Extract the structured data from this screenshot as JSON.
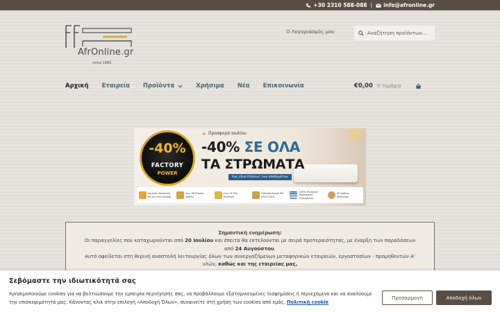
{
  "topbar": {
    "phone": "+30 2310 588-088",
    "separator": "|",
    "email": "info@afronline.gr"
  },
  "logo": {
    "name": "AfrOnline.gr",
    "since": "since 1982"
  },
  "header": {
    "account_label": "Ο Λογαριασμός μου",
    "search_placeholder": "Αναζήτηση προϊόντων..."
  },
  "nav": {
    "items": [
      {
        "label": "Αρχική"
      },
      {
        "label": "Εταιρεία"
      },
      {
        "label": "Προϊόντα"
      },
      {
        "label": "Χρήσιμα"
      },
      {
        "label": "Νέα"
      },
      {
        "label": "Επικοινωνία"
      }
    ]
  },
  "cart": {
    "amount": "€0,00",
    "count": "0 τεμάχια"
  },
  "banner": {
    "badge_percent": "-40%",
    "badge_line1": "FACTORY",
    "badge_line2": "POWER",
    "tag": "Προσφορά Ιουλίου",
    "headline_prefix": "-40%",
    "headline_highlight": "ΣΕ ΟΛΑ",
    "headline_line2": "ΤΑ ΣΤΡΩΜΑΤΑ",
    "subline": "έως εξαντλήσεως των αποθεμάτων",
    "features": [
      {
        "text": "Δωρεάν Αποστολή σε όλη την Ελλάδα",
        "color": "#e8a23a"
      },
      {
        "text": "έως 36 Άτοκες Δόσεις",
        "color": "#d4a347"
      },
      {
        "text": "έως 15 Έτη Εγγύηση",
        "color": "#e0b450"
      },
      {
        "text": "Πιστοποιητικό ISO 9001:2015",
        "color": "#c9a24a"
      },
      {
        "text": "100% Ελληνικό Βιομηχανία Στρωμάτων",
        "color": "#2e5d8c"
      },
      {
        "text": "45 Χρόνια Εμπειρίας",
        "color": "#caa25a"
      }
    ]
  },
  "notice": {
    "title": "Σημαντική ενημέρωση:",
    "line1_a": "Οι παραγγελίες που καταχωρούνται από",
    "line1_b": "20 Ιουλίου",
    "line1_c": "και έπειτα θα εκτελούνται με σειρά προτεραιότητας, με έναρξη των παραδόσεων",
    "line2_a": "από",
    "line2_b": "24 Αυγούστου",
    "line3": "Αυτό οφείλεται στη θερινή αναστολή λειτουργίας όλων των συνεργαζόμενων μεταφορικών εταιρειών, εργοστασίων - προμηθευτών Α'",
    "line4_a": "υλών,",
    "line4_b": "καθώς και της εταιρείας μας,"
  },
  "cookie": {
    "heading": "Σεβόμαστε την ιδιωτικότητά σας",
    "text": "Χρησιμοποιούμε cookies για να βελτιώσουμε την εμπειρία περιήγησής σας, να προβάλλουμε εξατομικευμένες διαφημίσεις ή περιεχόμενο και να αναλύουμε την επισκεψιμότητά μας. Κάνοντας κλικ στην επιλογή «Αποδοχή Όλων», συναινείτε στη χρήση των cookies από εμάς.",
    "policy_link": "Πολιτική cookie",
    "settings_button": "Προσαρμογή",
    "accept_button": "Αποδοχή όλων"
  },
  "colors": {
    "brand_brown": "#5a4d44",
    "nav_text": "#4a6572",
    "link_blue": "#1e4fb3"
  }
}
